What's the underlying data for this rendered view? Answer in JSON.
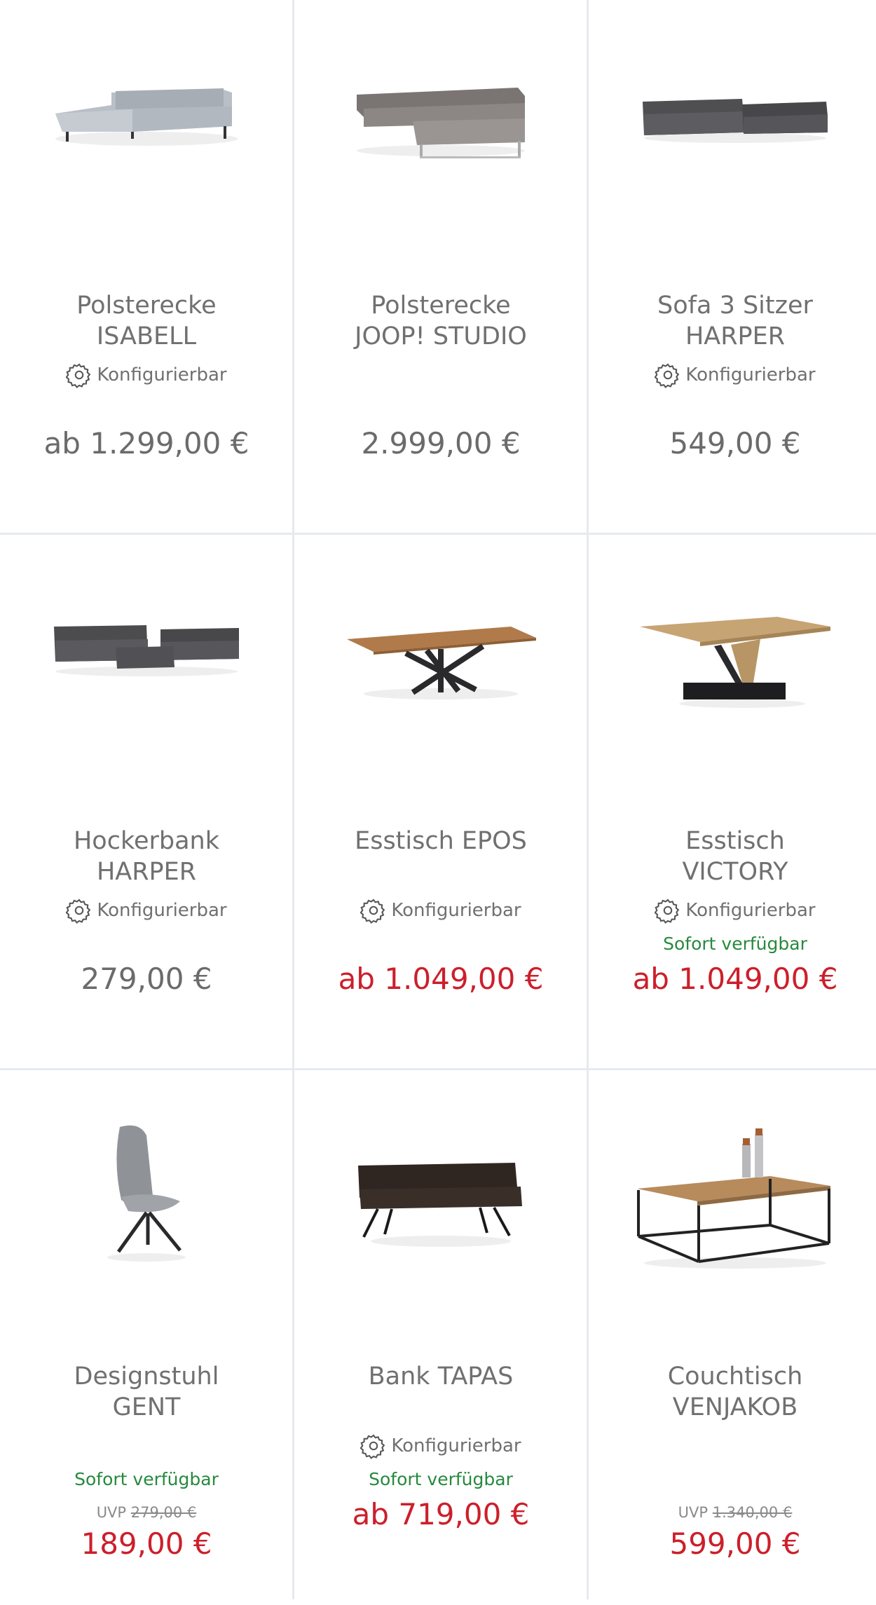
{
  "colors": {
    "text": "#707070",
    "price_sale": "#cc1f2b",
    "available": "#27893e",
    "divider": "#e6eaee"
  },
  "products": [
    {
      "title1": "Polsterecke",
      "title2": "ISABELL",
      "config": "Konfigurierbar",
      "price": "ab 1.299,00 €",
      "icon": "corner-sofa-light-grey"
    },
    {
      "title1": "Polsterecke",
      "title2": "JOOP! STUDIO",
      "price": "2.999,00 €",
      "icon": "corner-sofa-taupe"
    },
    {
      "title1": "Sofa 3 Sitzer",
      "title2": "HARPER",
      "config": "Konfigurierbar",
      "price": "549,00 €",
      "icon": "sofa-set-dark-grey"
    },
    {
      "title1": "Hockerbank",
      "title2": "HARPER",
      "config": "Konfigurierbar",
      "price": "279,00 €",
      "icon": "sofa-set-with-ottoman"
    },
    {
      "title1": "Esstisch EPOS",
      "config": "Konfigurierbar",
      "price": "ab 1.049,00 €",
      "icon": "dining-table-cross-legs"
    },
    {
      "title1": "Esstisch",
      "title2": "VICTORY",
      "config": "Konfigurierbar",
      "availability": "Sofort verfügbar",
      "price": "ab 1.049,00 €",
      "icon": "dining-table-v-base"
    },
    {
      "title1": "Designstuhl",
      "title2": "GENT",
      "availability": "Sofort verfügbar",
      "uvp_label": "UVP",
      "uvp_price": "279,00 €",
      "price": "189,00 €",
      "icon": "chair-grey"
    },
    {
      "title1": "Bank TAPAS",
      "config": "Konfigurierbar",
      "availability": "Sofort verfügbar",
      "price": "ab 719,00 €",
      "icon": "bench-dark-brown"
    },
    {
      "title1": "Couchtisch",
      "title2": "VENJAKOB",
      "uvp_label": "UVP",
      "uvp_price": "1.340,00 €",
      "price": "599,00 €",
      "icon": "coffee-table-with-candles"
    }
  ]
}
